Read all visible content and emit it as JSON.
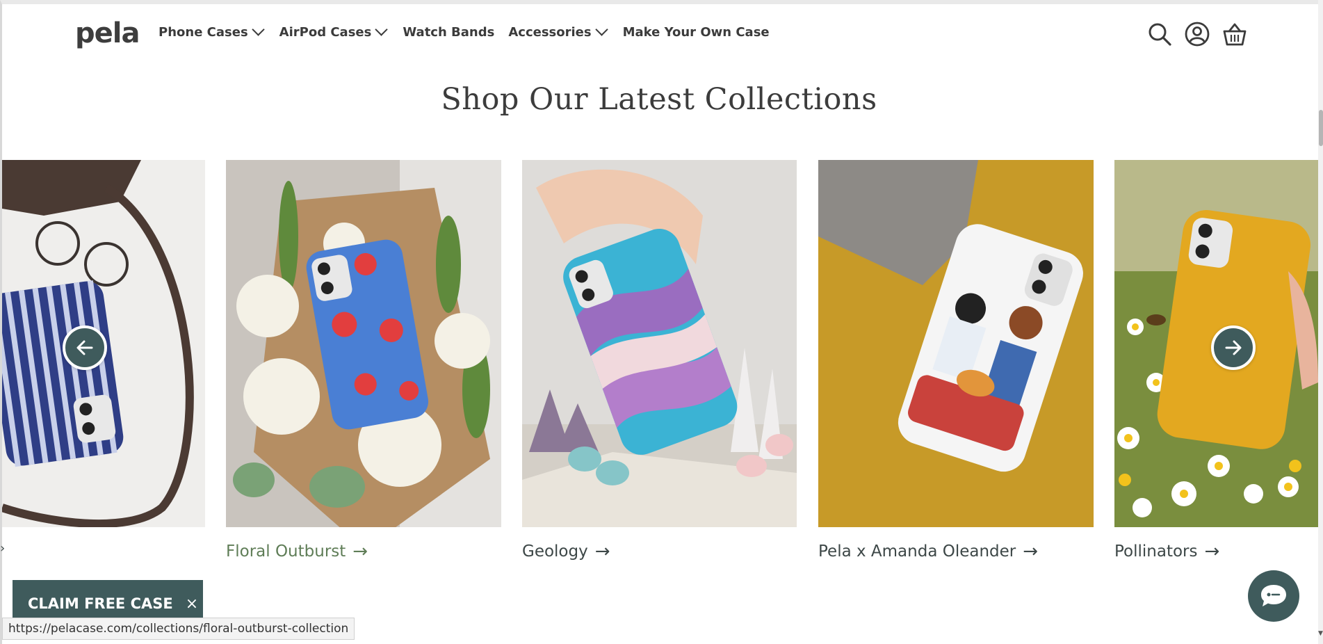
{
  "brand": {
    "logo_text": "pela",
    "accent": "#3f5b5c",
    "active_link": "#5f7d57"
  },
  "nav": {
    "items": [
      {
        "label": "Phone Cases",
        "dropdown": true
      },
      {
        "label": "AirPod Cases",
        "dropdown": true
      },
      {
        "label": "Watch Bands",
        "dropdown": false
      },
      {
        "label": "Accessories",
        "dropdown": true
      },
      {
        "label": "Make Your Own Case",
        "dropdown": false
      }
    ],
    "icons": [
      "search-icon",
      "account-icon",
      "cart-icon"
    ]
  },
  "section": {
    "title": "Shop Our Latest Collections"
  },
  "collections": [
    {
      "label": "",
      "icon": "striped-case-partial"
    },
    {
      "label": "Floral Outburst",
      "active": true
    },
    {
      "label": "Geology"
    },
    {
      "label": "Pela x Amanda Oleander"
    },
    {
      "label": "Pollinators"
    }
  ],
  "carousel": {
    "prev": "arrow-left-icon",
    "next": "arrow-right-icon"
  },
  "promo": {
    "label": "CLAIM FREE CASE",
    "close": "×"
  },
  "status_bar": {
    "url": "https://pelacase.com/collections/floral-outburst-collection"
  }
}
